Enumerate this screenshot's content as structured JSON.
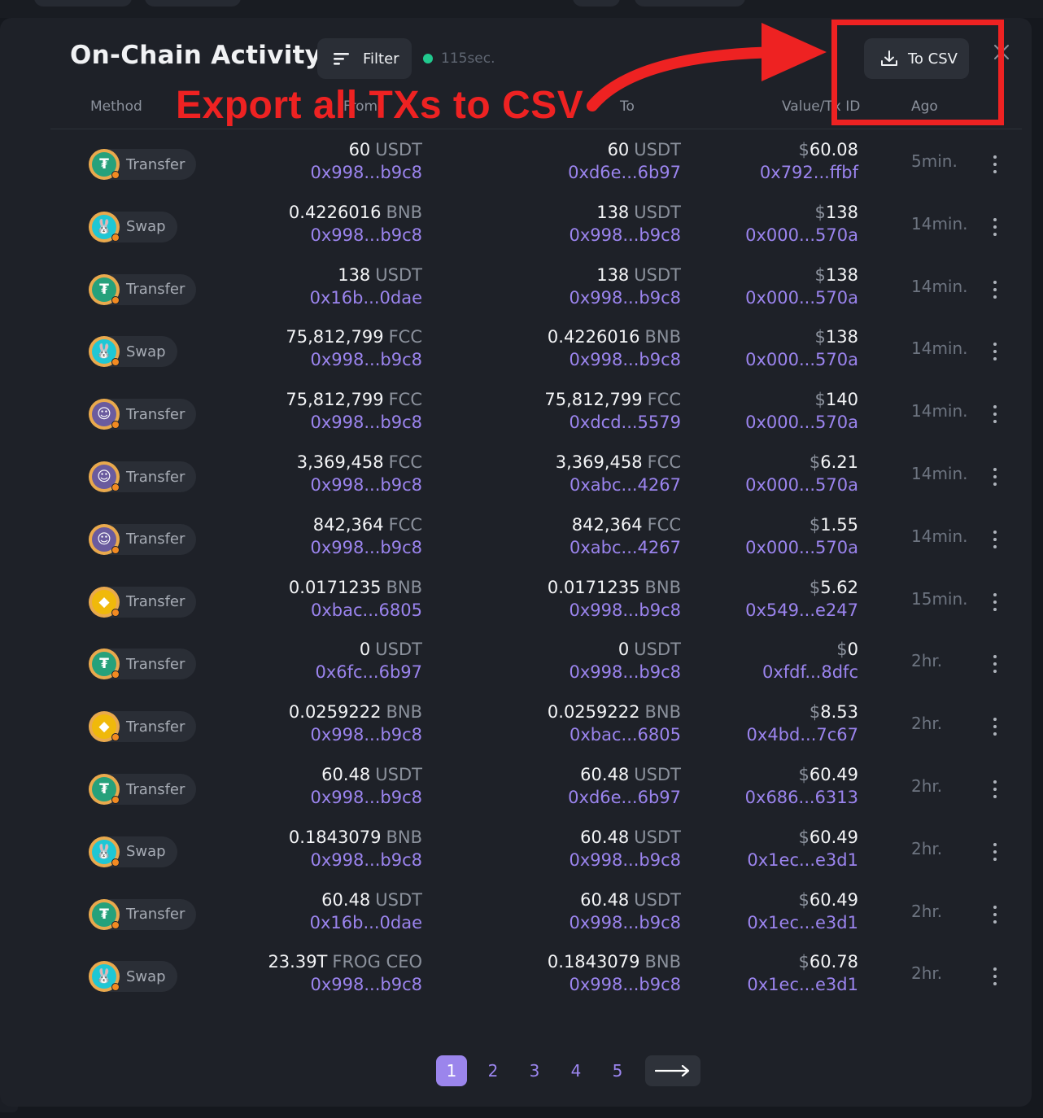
{
  "header": {
    "title": "On-Chain Activity",
    "filter_label": "Filter",
    "refresh_status": "115sec.",
    "csv_label": "To CSV"
  },
  "annotation": {
    "text": "Export all TXs to CSV",
    "color": "#ee2222"
  },
  "columns": {
    "method": "Method",
    "from": "From",
    "to": "To",
    "value": "Value/Tx ID",
    "ago": "Ago"
  },
  "rows": [
    {
      "method": "Transfer",
      "icon": "tether-icon",
      "from_amount": "60",
      "from_symbol": "USDT",
      "from_addr": "0x998...b9c8",
      "to_amount": "60",
      "to_symbol": "USDT",
      "to_addr": "0xd6e...6b97",
      "value_amount": "60.08",
      "tx_id": "0x792...ffbf",
      "ago": "5min."
    },
    {
      "method": "Swap",
      "icon": "pancakeswap-icon",
      "from_amount": "0.4226016",
      "from_symbol": "BNB",
      "from_addr": "0x998...b9c8",
      "to_amount": "138",
      "to_symbol": "USDT",
      "to_addr": "0x998...b9c8",
      "value_amount": "138",
      "tx_id": "0x000...570a",
      "ago": "14min."
    },
    {
      "method": "Transfer",
      "icon": "tether-icon",
      "from_amount": "138",
      "from_symbol": "USDT",
      "from_addr": "0x16b...0dae",
      "to_amount": "138",
      "to_symbol": "USDT",
      "to_addr": "0x998...b9c8",
      "value_amount": "138",
      "tx_id": "0x000...570a",
      "ago": "14min."
    },
    {
      "method": "Swap",
      "icon": "pancakeswap-icon",
      "from_amount": "75,812,799",
      "from_symbol": "FCC",
      "from_addr": "0x998...b9c8",
      "to_amount": "0.4226016",
      "to_symbol": "BNB",
      "to_addr": "0x998...b9c8",
      "value_amount": "138",
      "tx_id": "0x000...570a",
      "ago": "14min."
    },
    {
      "method": "Transfer",
      "icon": "fcc-token-icon",
      "from_amount": "75,812,799",
      "from_symbol": "FCC",
      "from_addr": "0x998...b9c8",
      "to_amount": "75,812,799",
      "to_symbol": "FCC",
      "to_addr": "0xdcd...5579",
      "value_amount": "140",
      "tx_id": "0x000...570a",
      "ago": "14min."
    },
    {
      "method": "Transfer",
      "icon": "fcc-token-icon",
      "from_amount": "3,369,458",
      "from_symbol": "FCC",
      "from_addr": "0x998...b9c8",
      "to_amount": "3,369,458",
      "to_symbol": "FCC",
      "to_addr": "0xabc...4267",
      "value_amount": "6.21",
      "tx_id": "0x000...570a",
      "ago": "14min."
    },
    {
      "method": "Transfer",
      "icon": "fcc-token-icon",
      "from_amount": "842,364",
      "from_symbol": "FCC",
      "from_addr": "0x998...b9c8",
      "to_amount": "842,364",
      "to_symbol": "FCC",
      "to_addr": "0xabc...4267",
      "value_amount": "1.55",
      "tx_id": "0x000...570a",
      "ago": "14min."
    },
    {
      "method": "Transfer",
      "icon": "bnb-icon",
      "from_amount": "0.0171235",
      "from_symbol": "BNB",
      "from_addr": "0xbac...6805",
      "to_amount": "0.0171235",
      "to_symbol": "BNB",
      "to_addr": "0x998...b9c8",
      "value_amount": "5.62",
      "tx_id": "0x549...e247",
      "ago": "15min."
    },
    {
      "method": "Transfer",
      "icon": "tether-icon",
      "from_amount": "0",
      "from_symbol": "USDT",
      "from_addr": "0x6fc...6b97",
      "to_amount": "0",
      "to_symbol": "USDT",
      "to_addr": "0x998...b9c8",
      "value_amount": "0",
      "tx_id": "0xfdf...8dfc",
      "ago": "2hr."
    },
    {
      "method": "Transfer",
      "icon": "bnb-icon",
      "from_amount": "0.0259222",
      "from_symbol": "BNB",
      "from_addr": "0x998...b9c8",
      "to_amount": "0.0259222",
      "to_symbol": "BNB",
      "to_addr": "0xbac...6805",
      "value_amount": "8.53",
      "tx_id": "0x4bd...7c67",
      "ago": "2hr."
    },
    {
      "method": "Transfer",
      "icon": "tether-icon",
      "from_amount": "60.48",
      "from_symbol": "USDT",
      "from_addr": "0x998...b9c8",
      "to_amount": "60.48",
      "to_symbol": "USDT",
      "to_addr": "0xd6e...6b97",
      "value_amount": "60.49",
      "tx_id": "0x686...6313",
      "ago": "2hr."
    },
    {
      "method": "Swap",
      "icon": "pancakeswap-icon",
      "from_amount": "0.1843079",
      "from_symbol": "BNB",
      "from_addr": "0x998...b9c8",
      "to_amount": "60.48",
      "to_symbol": "USDT",
      "to_addr": "0x998...b9c8",
      "value_amount": "60.49",
      "tx_id": "0x1ec...e3d1",
      "ago": "2hr."
    },
    {
      "method": "Transfer",
      "icon": "tether-icon",
      "from_amount": "60.48",
      "from_symbol": "USDT",
      "from_addr": "0x16b...0dae",
      "to_amount": "60.48",
      "to_symbol": "USDT",
      "to_addr": "0x998...b9c8",
      "value_amount": "60.49",
      "tx_id": "0x1ec...e3d1",
      "ago": "2hr."
    },
    {
      "method": "Swap",
      "icon": "pancakeswap-icon",
      "from_amount": "23.39T",
      "from_symbol": "FROG CEO",
      "from_addr": "0x998...b9c8",
      "to_amount": "0.1843079",
      "to_symbol": "BNB",
      "to_addr": "0x998...b9c8",
      "value_amount": "60.78",
      "tx_id": "0x1ec...e3d1",
      "ago": "2hr."
    }
  ],
  "pagination": {
    "pages": [
      "1",
      "2",
      "3",
      "4",
      "5"
    ],
    "current": "1"
  },
  "colors": {
    "accent": "#9b85ec",
    "live": "#21c98e",
    "tether": "#26a17b",
    "bnb": "#f0b90b",
    "pancake": "#1fc7d4"
  }
}
